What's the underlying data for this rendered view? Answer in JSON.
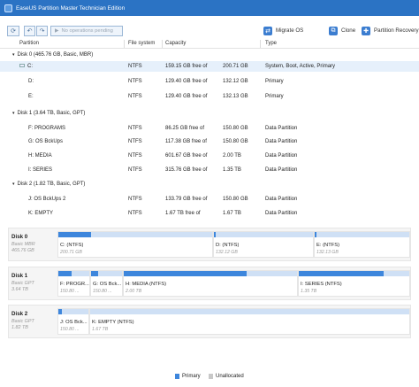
{
  "app": {
    "title": "EaseUS Partition Master Technician Edition"
  },
  "toolbar": {
    "pending_label": "No operations pending",
    "migrate_label": "Migrate OS",
    "clone_label": "Clone",
    "recovery_label": "Partition Recovery"
  },
  "table": {
    "headers": {
      "partition": "Partition",
      "filesystem": "File system",
      "capacity": "Capacity",
      "type": "Type"
    },
    "rows": [
      {
        "kind": "disk",
        "name": "Disk 0 (465.76 GB, Basic, MBR)"
      },
      {
        "kind": "part",
        "name": "C:",
        "fs": "NTFS",
        "free": "159.15 GB free of",
        "total": "200.71 GB",
        "type": "System, Boot, Active, Primary",
        "selected": true
      },
      {
        "kind": "part",
        "name": "D:",
        "fs": "NTFS",
        "free": "129.40 GB free of",
        "total": "132.12 GB",
        "type": "Primary"
      },
      {
        "kind": "part",
        "name": "E:",
        "fs": "NTFS",
        "free": "129.40 GB free of",
        "total": "132.13 GB",
        "type": "Primary"
      },
      {
        "kind": "disk",
        "name": "Disk 1 (3.64 TB, Basic, GPT)"
      },
      {
        "kind": "part",
        "name": "F: PROGRAMS",
        "fs": "NTFS",
        "free": "86.25 GB free of",
        "total": "150.80 GB",
        "type": "Data Partition"
      },
      {
        "kind": "part",
        "name": "G: OS BckUps",
        "fs": "NTFS",
        "free": "117.38 GB free of",
        "total": "150.80 GB",
        "type": "Data Partition"
      },
      {
        "kind": "part",
        "name": "H: MEDIA",
        "fs": "NTFS",
        "free": "601.67 GB free of",
        "total": "2.00 TB",
        "type": "Data Partition"
      },
      {
        "kind": "part",
        "name": "I: SERIES",
        "fs": "NTFS",
        "free": "315.76 GB free of",
        "total": "1.35 TB",
        "type": "Data Partition"
      },
      {
        "kind": "disk",
        "name": "Disk 2 (1.82 TB, Basic, GPT)"
      },
      {
        "kind": "part",
        "name": "J: OS BckUps 2",
        "fs": "NTFS",
        "free": "133.79 GB free of",
        "total": "150.80 GB",
        "type": "Data Partition"
      },
      {
        "kind": "part",
        "name": "K: EMPTY",
        "fs": "NTFS",
        "free": "1.67 TB free of",
        "total": "1.67 TB",
        "type": "Data Partition"
      }
    ]
  },
  "map": {
    "disks": [
      {
        "name": "Disk 0",
        "sub1": "Basic MBR",
        "sub2": "465.76 GB",
        "parts": [
          {
            "label": "C: (NTFS)",
            "size": "200.71 GB",
            "used": 0.21
          },
          {
            "label": "D: (NTFS)",
            "size": "132.12 GB",
            "used": 0.02
          },
          {
            "label": "E: (NTFS)",
            "size": "132.13 GB",
            "used": 0.02
          }
        ]
      },
      {
        "name": "Disk 1",
        "sub1": "Basic GPT",
        "sub2": "3.64 TB",
        "parts": [
          {
            "label": "F: PROGR...",
            "size": "150.80 ...",
            "used": 0.43
          },
          {
            "label": "G: OS Bck...",
            "size": "150.80 ...",
            "used": 0.22
          },
          {
            "label": "H: MEDIA (NTFS)",
            "size": "2.00 TB",
            "used": 0.71
          },
          {
            "label": "I: SERIES (NTFS)",
            "size": "1.35 TB",
            "used": 0.77
          }
        ]
      },
      {
        "name": "Disk 2",
        "sub1": "Basic GPT",
        "sub2": "1.82 TB",
        "parts": [
          {
            "label": "J: OS Bck...",
            "size": "150.80 ...",
            "used": 0.11
          },
          {
            "label": "K: EMPTY (NTFS)",
            "size": "1.67 TB",
            "used": 0.0
          }
        ]
      }
    ]
  },
  "legend": {
    "primary": "Primary",
    "unallocated": "Unallocated"
  },
  "colors": {
    "titlebar": "#2b73c4",
    "used": "#3d86dc",
    "free": "#cfe0f5",
    "unallocated": "#c8c8c8",
    "selected_row": "#e6f0fb"
  }
}
